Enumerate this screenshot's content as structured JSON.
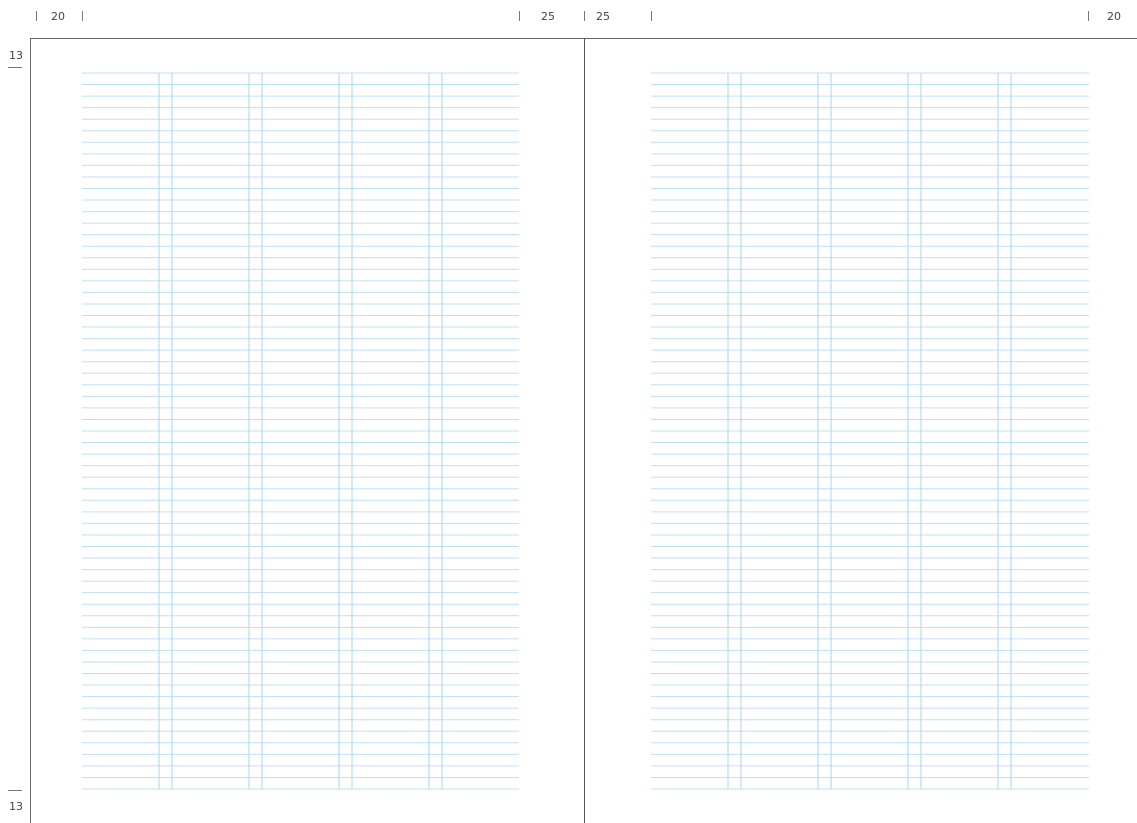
{
  "ruler": {
    "top_left_margin": "20",
    "top_inner_left": "25",
    "top_inner_right": "25",
    "top_right_margin": "20",
    "side_top": "13",
    "side_bottom": "13"
  },
  "grid": {
    "rule_color": "#bfe0f3",
    "column_rule_color": "#a9d4ee",
    "rows": 62
  }
}
